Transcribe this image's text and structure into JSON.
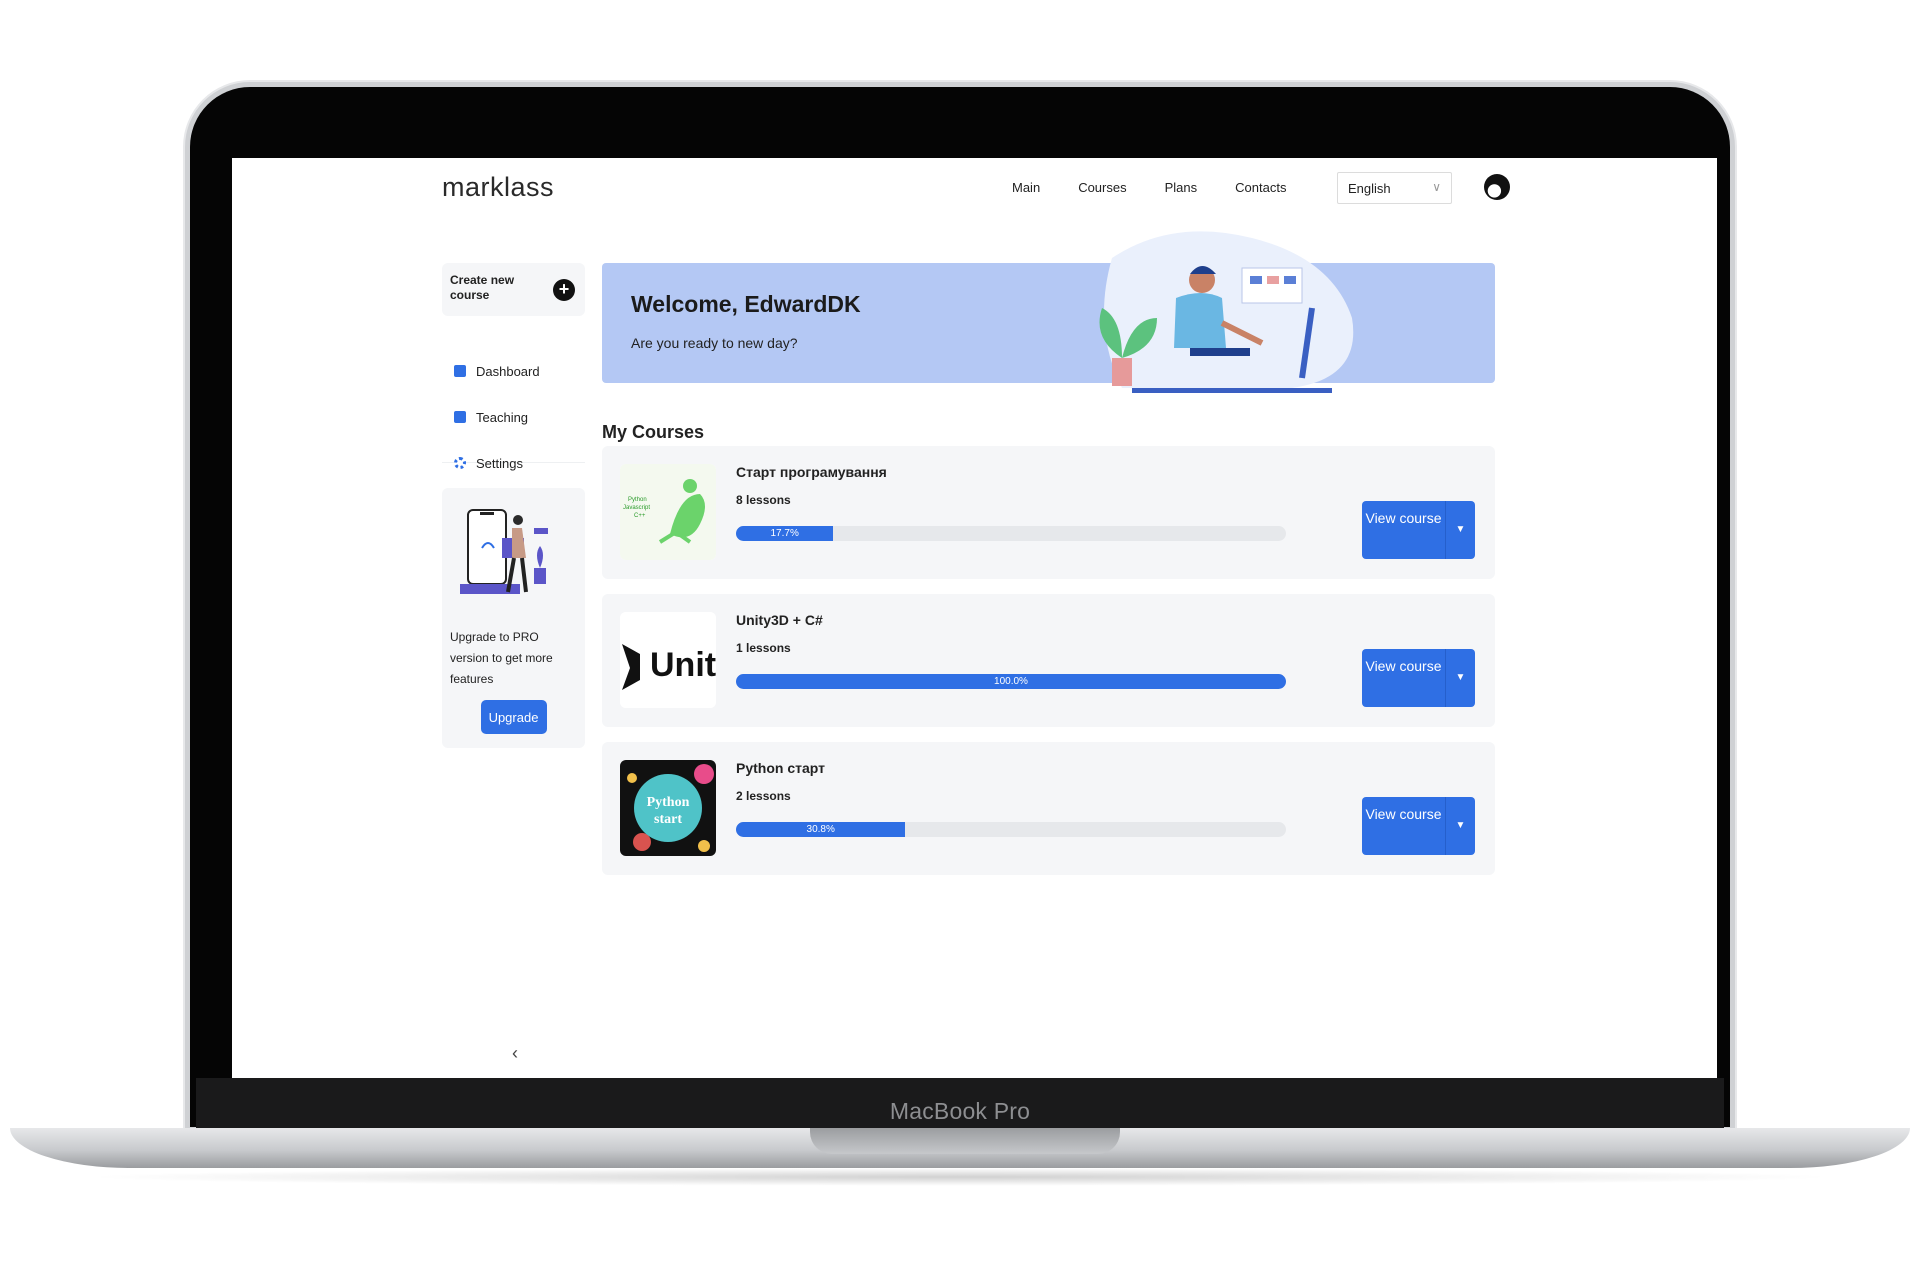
{
  "device": {
    "label": "MacBook Pro"
  },
  "header": {
    "logo": "marklass",
    "nav": [
      "Main",
      "Courses",
      "Plans",
      "Contacts"
    ],
    "language": "English"
  },
  "sidebar": {
    "create_label": "Create new course",
    "items": [
      {
        "label": "Dashboard",
        "icon": "dashboard-icon"
      },
      {
        "label": "Teaching",
        "icon": "book-icon"
      },
      {
        "label": "Settings",
        "icon": "gear-icon"
      }
    ],
    "upgrade_text": "Upgrade to PRO version to get more features",
    "upgrade_button": "Upgrade"
  },
  "welcome": {
    "title": "Welcome, EdwardDK",
    "subtitle": "Are you ready to new day?"
  },
  "courses_section": {
    "title": "My Courses",
    "view_label": "View course",
    "items": [
      {
        "title": "Старт програмування",
        "lessons": "8 lessons",
        "progress_label": "17.7%",
        "progress": 17.7,
        "thumb_text": [
          "Python",
          "Javascript",
          "C++"
        ]
      },
      {
        "title": "Unity3D + C#",
        "lessons": "1 lessons",
        "progress_label": "100.0%",
        "progress": 100.0,
        "thumb_text": [
          "Unit"
        ]
      },
      {
        "title": "Python старт",
        "lessons": "2 lessons",
        "progress_label": "30.8%",
        "progress": 30.8,
        "thumb_text": [
          "Python",
          "start"
        ]
      }
    ]
  },
  "colors": {
    "accent": "#2f6fe4",
    "banner": "#b4c8f4",
    "card": "#f5f6f8"
  }
}
